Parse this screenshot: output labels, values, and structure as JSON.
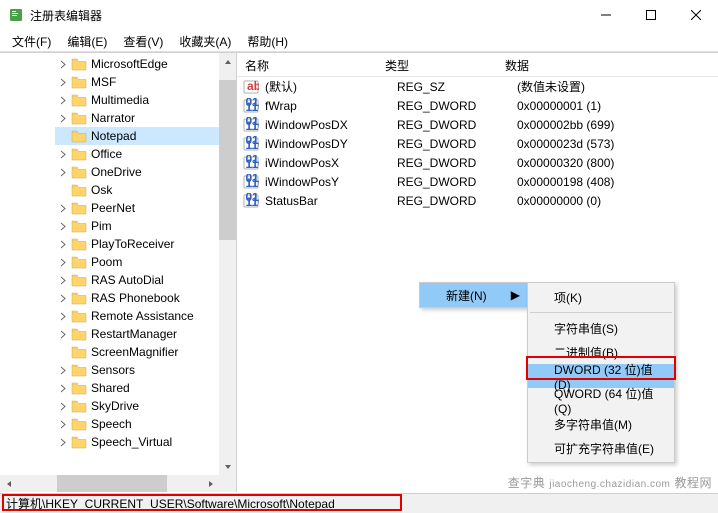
{
  "window": {
    "title": "注册表编辑器"
  },
  "menubar": {
    "items": [
      "文件(F)",
      "编辑(E)",
      "查看(V)",
      "收藏夹(A)",
      "帮助(H)"
    ]
  },
  "tree": {
    "items": [
      {
        "label": "MicrosoftEdge",
        "expandable": true
      },
      {
        "label": "MSF",
        "expandable": true
      },
      {
        "label": "Multimedia",
        "expandable": true
      },
      {
        "label": "Narrator",
        "expandable": true
      },
      {
        "label": "Notepad",
        "expandable": false,
        "selected": true
      },
      {
        "label": "Office",
        "expandable": true
      },
      {
        "label": "OneDrive",
        "expandable": true
      },
      {
        "label": "Osk",
        "expandable": false
      },
      {
        "label": "PeerNet",
        "expandable": true
      },
      {
        "label": "Pim",
        "expandable": true
      },
      {
        "label": "PlayToReceiver",
        "expandable": true
      },
      {
        "label": "Poom",
        "expandable": true
      },
      {
        "label": "RAS AutoDial",
        "expandable": true
      },
      {
        "label": "RAS Phonebook",
        "expandable": true
      },
      {
        "label": "Remote Assistance",
        "expandable": true
      },
      {
        "label": "RestartManager",
        "expandable": true
      },
      {
        "label": "ScreenMagnifier",
        "expandable": false
      },
      {
        "label": "Sensors",
        "expandable": true
      },
      {
        "label": "Shared",
        "expandable": true
      },
      {
        "label": "SkyDrive",
        "expandable": true
      },
      {
        "label": "Speech",
        "expandable": true
      },
      {
        "label": "Speech_Virtual",
        "expandable": true
      }
    ]
  },
  "list": {
    "columns": {
      "name": "名称",
      "type": "类型",
      "data": "数据"
    },
    "rows": [
      {
        "icon": "str",
        "name": "(默认)",
        "type": "REG_SZ",
        "data": "(数值未设置)"
      },
      {
        "icon": "bin",
        "name": "fWrap",
        "type": "REG_DWORD",
        "data": "0x00000001 (1)"
      },
      {
        "icon": "bin",
        "name": "iWindowPosDX",
        "type": "REG_DWORD",
        "data": "0x000002bb (699)"
      },
      {
        "icon": "bin",
        "name": "iWindowPosDY",
        "type": "REG_DWORD",
        "data": "0x0000023d (573)"
      },
      {
        "icon": "bin",
        "name": "iWindowPosX",
        "type": "REG_DWORD",
        "data": "0x00000320 (800)"
      },
      {
        "icon": "bin",
        "name": "iWindowPosY",
        "type": "REG_DWORD",
        "data": "0x00000198 (408)"
      },
      {
        "icon": "bin",
        "name": "StatusBar",
        "type": "REG_DWORD",
        "data": "0x00000000 (0)"
      }
    ]
  },
  "context": {
    "new_label": "新建(N)",
    "submenu": [
      {
        "label": "项(K)"
      },
      {
        "sep": true
      },
      {
        "label": "字符串值(S)"
      },
      {
        "label": "二进制值(B)"
      },
      {
        "label": "DWORD (32 位)值(D)",
        "highlighted": true
      },
      {
        "label": "QWORD (64 位)值(Q)"
      },
      {
        "label": "多字符串值(M)"
      },
      {
        "label": "可扩充字符串值(E)"
      }
    ]
  },
  "statusbar": {
    "path": "计算机\\HKEY_CURRENT_USER\\Software\\Microsoft\\Notepad"
  },
  "watermark": {
    "a": "查字典",
    "b": "jiaocheng.chazidian.com",
    "c": "教程网"
  }
}
